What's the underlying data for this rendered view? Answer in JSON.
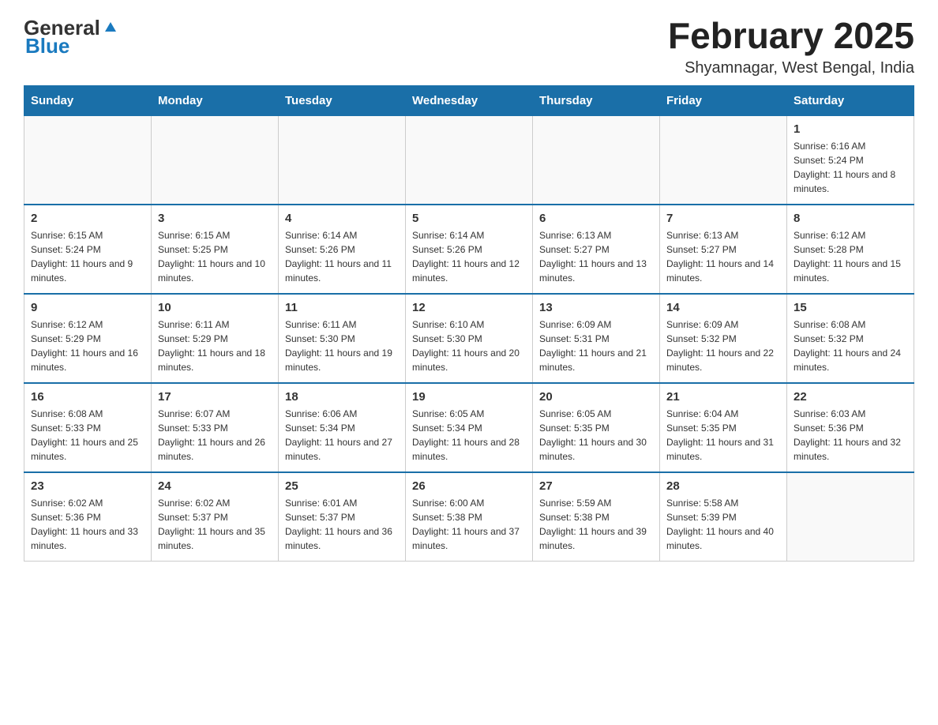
{
  "header": {
    "logo_general": "General",
    "logo_blue": "Blue",
    "title": "February 2025",
    "location": "Shyamnagar, West Bengal, India"
  },
  "days_of_week": [
    "Sunday",
    "Monday",
    "Tuesday",
    "Wednesday",
    "Thursday",
    "Friday",
    "Saturday"
  ],
  "weeks": [
    [
      {
        "day": "",
        "info": ""
      },
      {
        "day": "",
        "info": ""
      },
      {
        "day": "",
        "info": ""
      },
      {
        "day": "",
        "info": ""
      },
      {
        "day": "",
        "info": ""
      },
      {
        "day": "",
        "info": ""
      },
      {
        "day": "1",
        "info": "Sunrise: 6:16 AM\nSunset: 5:24 PM\nDaylight: 11 hours and 8 minutes."
      }
    ],
    [
      {
        "day": "2",
        "info": "Sunrise: 6:15 AM\nSunset: 5:24 PM\nDaylight: 11 hours and 9 minutes."
      },
      {
        "day": "3",
        "info": "Sunrise: 6:15 AM\nSunset: 5:25 PM\nDaylight: 11 hours and 10 minutes."
      },
      {
        "day": "4",
        "info": "Sunrise: 6:14 AM\nSunset: 5:26 PM\nDaylight: 11 hours and 11 minutes."
      },
      {
        "day": "5",
        "info": "Sunrise: 6:14 AM\nSunset: 5:26 PM\nDaylight: 11 hours and 12 minutes."
      },
      {
        "day": "6",
        "info": "Sunrise: 6:13 AM\nSunset: 5:27 PM\nDaylight: 11 hours and 13 minutes."
      },
      {
        "day": "7",
        "info": "Sunrise: 6:13 AM\nSunset: 5:27 PM\nDaylight: 11 hours and 14 minutes."
      },
      {
        "day": "8",
        "info": "Sunrise: 6:12 AM\nSunset: 5:28 PM\nDaylight: 11 hours and 15 minutes."
      }
    ],
    [
      {
        "day": "9",
        "info": "Sunrise: 6:12 AM\nSunset: 5:29 PM\nDaylight: 11 hours and 16 minutes."
      },
      {
        "day": "10",
        "info": "Sunrise: 6:11 AM\nSunset: 5:29 PM\nDaylight: 11 hours and 18 minutes."
      },
      {
        "day": "11",
        "info": "Sunrise: 6:11 AM\nSunset: 5:30 PM\nDaylight: 11 hours and 19 minutes."
      },
      {
        "day": "12",
        "info": "Sunrise: 6:10 AM\nSunset: 5:30 PM\nDaylight: 11 hours and 20 minutes."
      },
      {
        "day": "13",
        "info": "Sunrise: 6:09 AM\nSunset: 5:31 PM\nDaylight: 11 hours and 21 minutes."
      },
      {
        "day": "14",
        "info": "Sunrise: 6:09 AM\nSunset: 5:32 PM\nDaylight: 11 hours and 22 minutes."
      },
      {
        "day": "15",
        "info": "Sunrise: 6:08 AM\nSunset: 5:32 PM\nDaylight: 11 hours and 24 minutes."
      }
    ],
    [
      {
        "day": "16",
        "info": "Sunrise: 6:08 AM\nSunset: 5:33 PM\nDaylight: 11 hours and 25 minutes."
      },
      {
        "day": "17",
        "info": "Sunrise: 6:07 AM\nSunset: 5:33 PM\nDaylight: 11 hours and 26 minutes."
      },
      {
        "day": "18",
        "info": "Sunrise: 6:06 AM\nSunset: 5:34 PM\nDaylight: 11 hours and 27 minutes."
      },
      {
        "day": "19",
        "info": "Sunrise: 6:05 AM\nSunset: 5:34 PM\nDaylight: 11 hours and 28 minutes."
      },
      {
        "day": "20",
        "info": "Sunrise: 6:05 AM\nSunset: 5:35 PM\nDaylight: 11 hours and 30 minutes."
      },
      {
        "day": "21",
        "info": "Sunrise: 6:04 AM\nSunset: 5:35 PM\nDaylight: 11 hours and 31 minutes."
      },
      {
        "day": "22",
        "info": "Sunrise: 6:03 AM\nSunset: 5:36 PM\nDaylight: 11 hours and 32 minutes."
      }
    ],
    [
      {
        "day": "23",
        "info": "Sunrise: 6:02 AM\nSunset: 5:36 PM\nDaylight: 11 hours and 33 minutes."
      },
      {
        "day": "24",
        "info": "Sunrise: 6:02 AM\nSunset: 5:37 PM\nDaylight: 11 hours and 35 minutes."
      },
      {
        "day": "25",
        "info": "Sunrise: 6:01 AM\nSunset: 5:37 PM\nDaylight: 11 hours and 36 minutes."
      },
      {
        "day": "26",
        "info": "Sunrise: 6:00 AM\nSunset: 5:38 PM\nDaylight: 11 hours and 37 minutes."
      },
      {
        "day": "27",
        "info": "Sunrise: 5:59 AM\nSunset: 5:38 PM\nDaylight: 11 hours and 39 minutes."
      },
      {
        "day": "28",
        "info": "Sunrise: 5:58 AM\nSunset: 5:39 PM\nDaylight: 11 hours and 40 minutes."
      },
      {
        "day": "",
        "info": ""
      }
    ]
  ]
}
